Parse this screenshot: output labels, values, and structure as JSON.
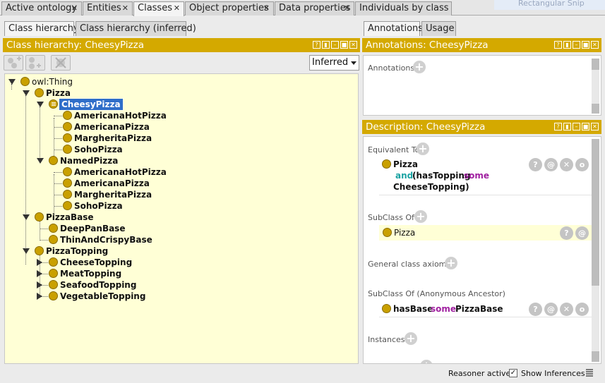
{
  "top_tabs": [
    {
      "label": "Active ontology",
      "active": false
    },
    {
      "label": "Entities",
      "active": false
    },
    {
      "label": "Classes",
      "active": true
    },
    {
      "label": "Object properties",
      "active": false
    },
    {
      "label": "Data properties",
      "active": false
    },
    {
      "label": "Individuals by class",
      "active": false
    }
  ],
  "ghost_text": "Rectangular Snip",
  "left": {
    "sub_tabs": [
      {
        "label": "Class hierarchy",
        "active": true
      },
      {
        "label": "Class hierarchy (inferred)",
        "active": false
      }
    ],
    "header": "Class hierarchy: CheesyPizza",
    "select_value": "Inferred",
    "tree": [
      {
        "label": "owl:Thing"
      },
      {
        "label": "Pizza"
      },
      {
        "label": "CheesyPizza",
        "selected": true
      },
      {
        "label": "AmericanaHotPizza"
      },
      {
        "label": "AmericanaPizza"
      },
      {
        "label": "MargheritaPizza"
      },
      {
        "label": "SohoPizza"
      },
      {
        "label": "NamedPizza"
      },
      {
        "label": "AmericanaHotPizza"
      },
      {
        "label": "AmericanaPizza"
      },
      {
        "label": "MargheritaPizza"
      },
      {
        "label": "SohoPizza"
      },
      {
        "label": "PizzaBase"
      },
      {
        "label": "DeepPanBase"
      },
      {
        "label": "ThinAndCrispyBase"
      },
      {
        "label": "PizzaTopping"
      },
      {
        "label": "CheeseTopping"
      },
      {
        "label": "MeatTopping"
      },
      {
        "label": "SeafoodTopping"
      },
      {
        "label": "VegetableTopping"
      }
    ]
  },
  "right": {
    "sub_tabs": [
      {
        "label": "Annotations",
        "active": true
      },
      {
        "label": "Usage",
        "active": false
      }
    ],
    "annotations_header": "Annotations: CheesyPizza",
    "annotations_label": "Annotations",
    "description_header": "Description: CheesyPizza",
    "sections": {
      "equivalent_to": "Equivalent To",
      "subclass_of": "SubClass Of",
      "general_axioms": "General class axioms",
      "subclass_anon": "SubClass Of (Anonymous Ancestor)",
      "instances": "Instances"
    },
    "equivalent": {
      "class": "Pizza",
      "and_kw": "and",
      "open": "(hasTopping",
      "some_kw": "some",
      "filler": "CheeseTopping)"
    },
    "subclass": {
      "class": "Pizza"
    },
    "anon": {
      "prop": "hasBase",
      "some_kw": "some",
      "filler": "PizzaBase"
    },
    "btn": {
      "help": "?",
      "annot": "@",
      "delete": "✕",
      "edit": "o"
    }
  },
  "status": {
    "reasoner": "Reasoner active",
    "show_inferences": "Show Inferences",
    "show_inferences_checked": "✓"
  },
  "colors": {
    "header_gold": "#d4a900",
    "class_dot": "#c9a000",
    "tree_bg": "#ffffd6",
    "selection": "#2f6ec9",
    "keyword_teal": "#1aa3a3",
    "keyword_purple": "#a020a0"
  }
}
